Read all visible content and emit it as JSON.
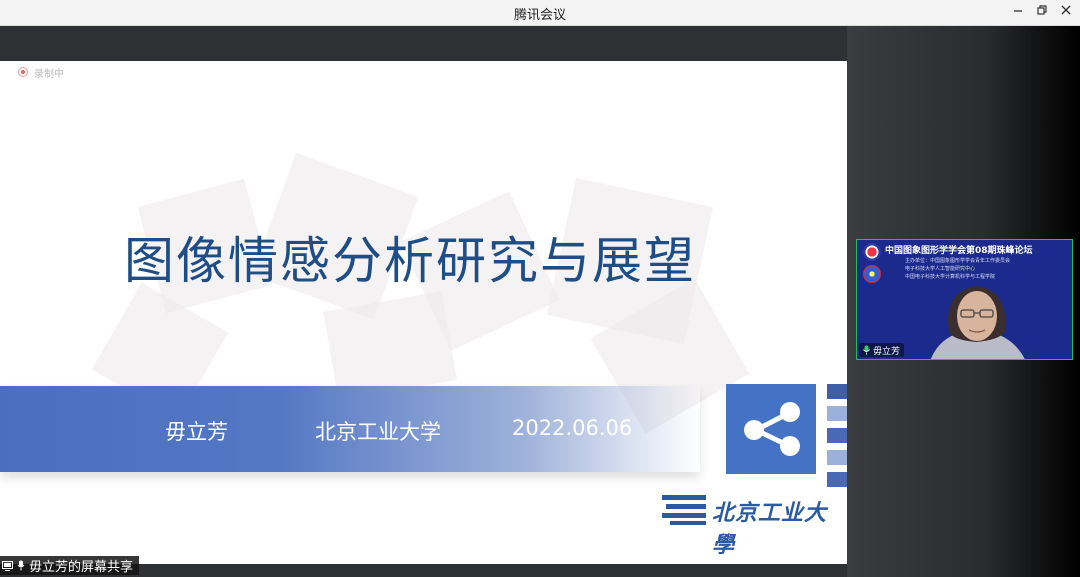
{
  "window": {
    "title": "腾讯会议"
  },
  "recording": {
    "label": "录制中"
  },
  "slide": {
    "title": "图像情感分析研究与展望",
    "presenter": "毋立芳",
    "affiliation": "北京工业大学",
    "date": "2022.06.06",
    "logo_text": "北京工业大學"
  },
  "sharing": {
    "label": "毋立芳的屏幕共享"
  },
  "participant": {
    "name": "毋立芳",
    "banner_title": "中国图象图形学学会第08期珠峰论坛",
    "banner_lines": [
      "主办单位：中国图象图形学学会青年工作委员会",
      "电子科技大学人工智能研究中心",
      "中国电子科技大学计算机科学与工程学院"
    ]
  },
  "colors": {
    "accent_blue": "#4472c4",
    "title_blue": "#1f4e86",
    "tile_border": "#2fb85a"
  }
}
